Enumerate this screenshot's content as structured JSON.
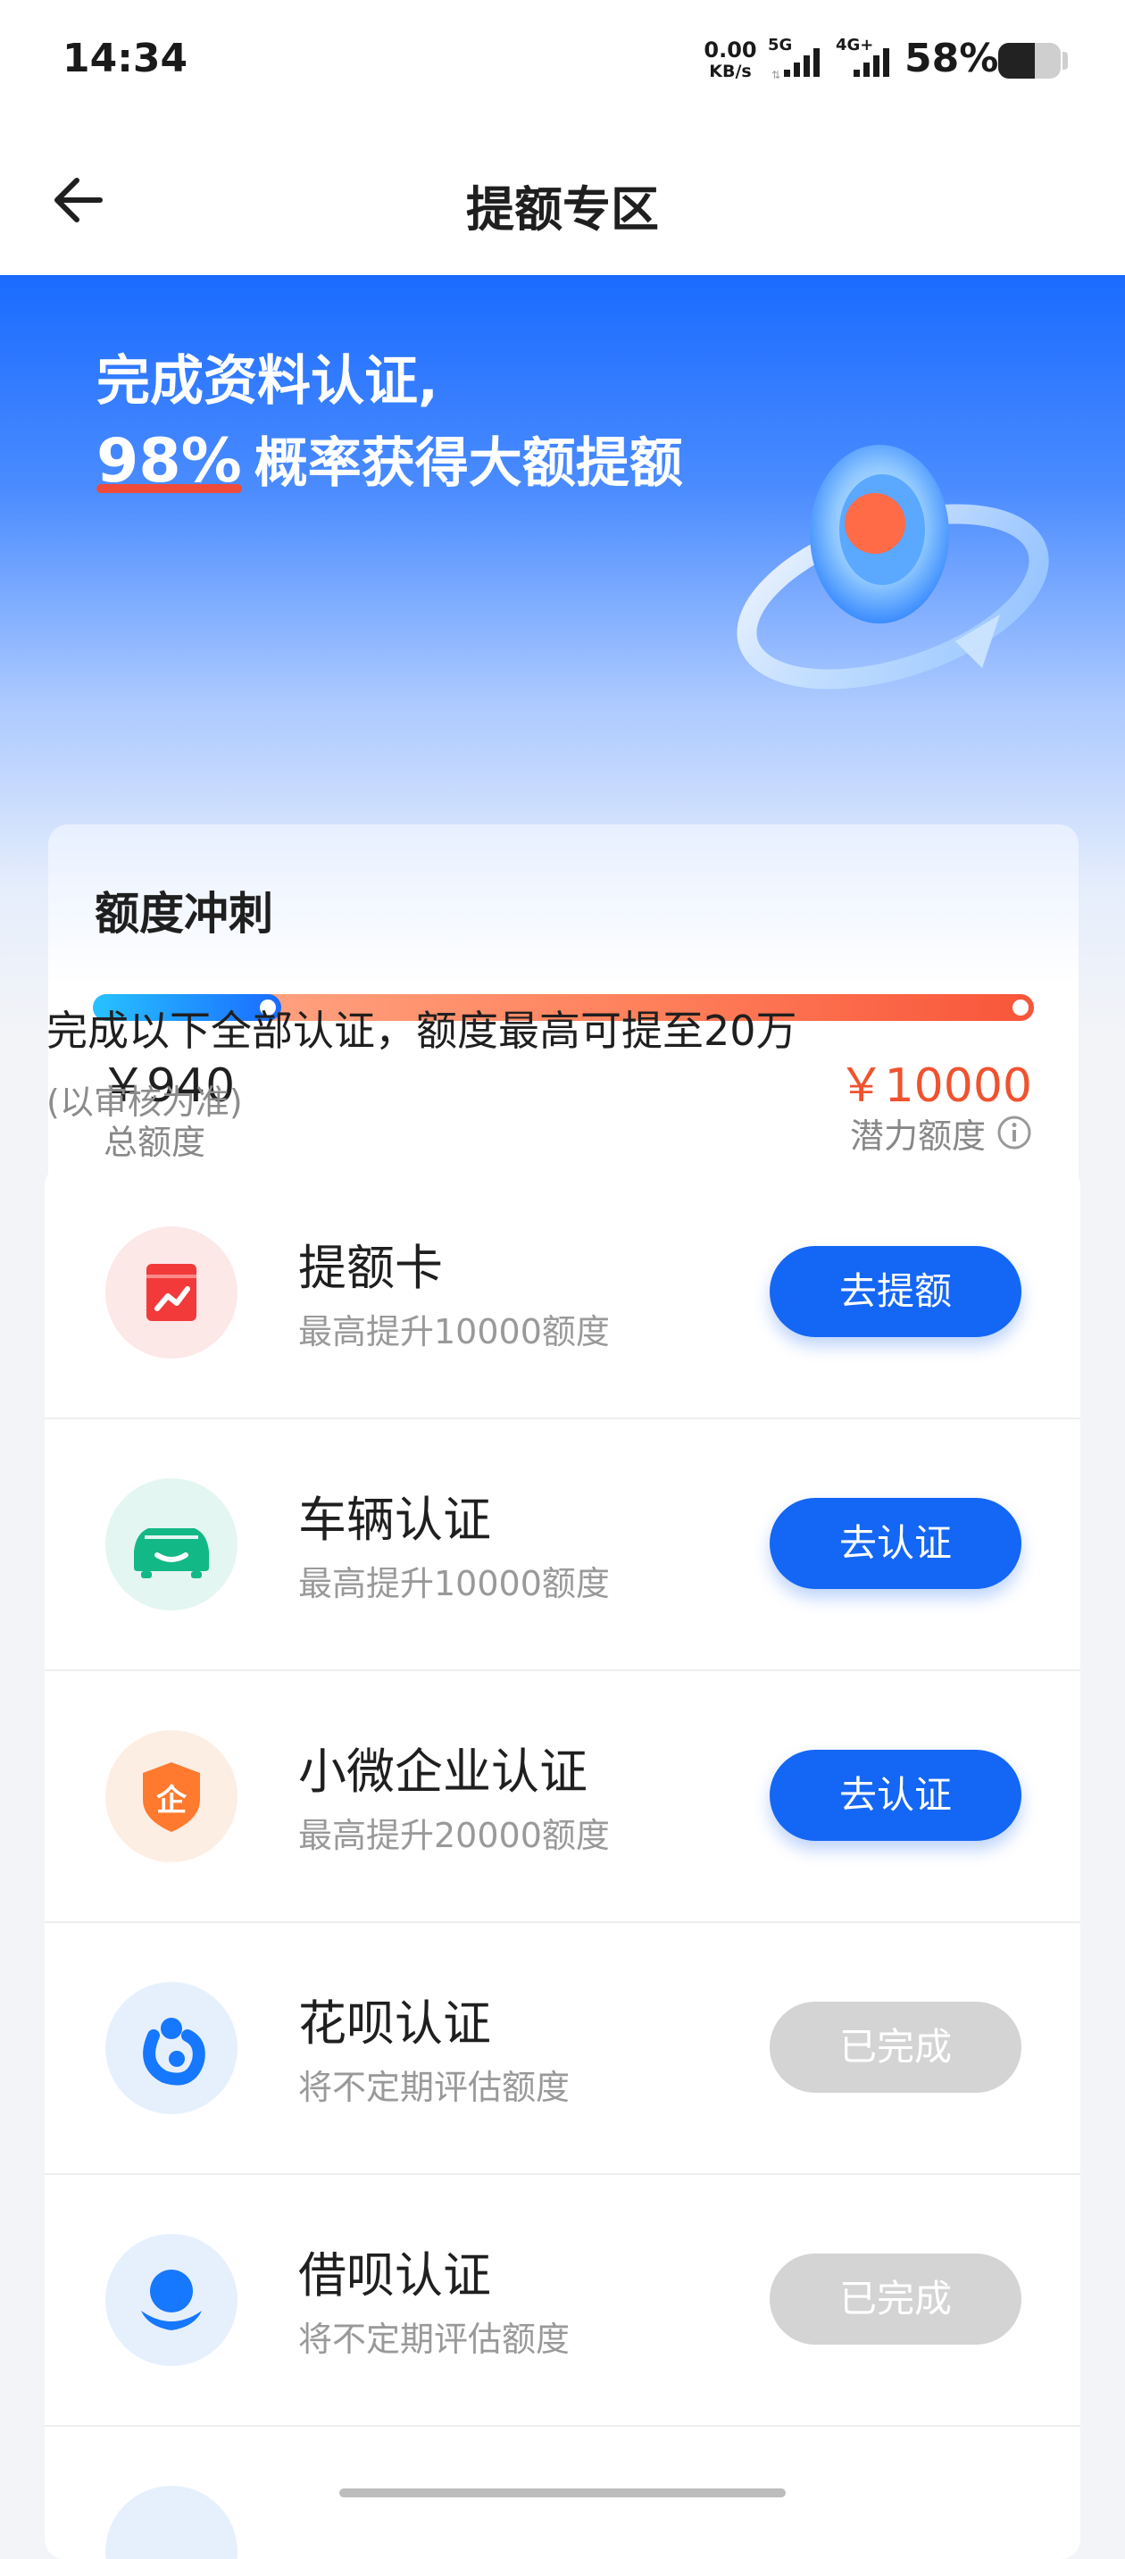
{
  "status_bar": {
    "time": "14:34",
    "net_speed_value": "0.00",
    "net_speed_unit": "KB/s",
    "signal_1_label": "5G",
    "signal_2_label": "4G+",
    "battery_percent": "58%",
    "battery_level": 0.58
  },
  "nav": {
    "title": "提额专区",
    "back_icon": "arrow-left-icon"
  },
  "hero": {
    "line1": "完成资料认证,",
    "percent": "98%",
    "line2_suffix": "概率获得大额提额"
  },
  "quota_card": {
    "title": "额度冲刺",
    "current_amount": "￥940",
    "current_label": "总额度",
    "potential_amount": "￥10000",
    "potential_label": "潜力额度",
    "progress_ratio": 0.2,
    "info_icon": "info-icon"
  },
  "hint": {
    "main": "完成以下全部认证，额度最高可提至20万",
    "sub": "(以审核为准)"
  },
  "tasks": [
    {
      "title": "提额卡",
      "desc": "最高提升10000额度",
      "button": "去提额",
      "state": "active",
      "icon": "raise-card-icon",
      "icon_bg": "#fde8e8"
    },
    {
      "title": "车辆认证",
      "desc": "最高提升10000额度",
      "button": "去认证",
      "state": "active",
      "icon": "car-icon",
      "icon_bg": "#e3f6f1"
    },
    {
      "title": "小微企业认证",
      "desc": "最高提升20000额度",
      "button": "去认证",
      "state": "active",
      "icon": "enterprise-shield-icon",
      "icon_bg": "#fdeee4"
    },
    {
      "title": "花呗认证",
      "desc": "将不定期评估额度",
      "button": "已完成",
      "state": "done",
      "icon": "huabei-icon",
      "icon_bg": "#e6f0fd"
    },
    {
      "title": "借呗认证",
      "desc": "将不定期评估额度",
      "button": "已完成",
      "state": "done",
      "icon": "jiebei-icon",
      "icon_bg": "#e6f0fd"
    }
  ],
  "colors": {
    "primary": "#1466f5",
    "accent_red": "#f0522f",
    "done_gray": "#d4d4d4"
  }
}
